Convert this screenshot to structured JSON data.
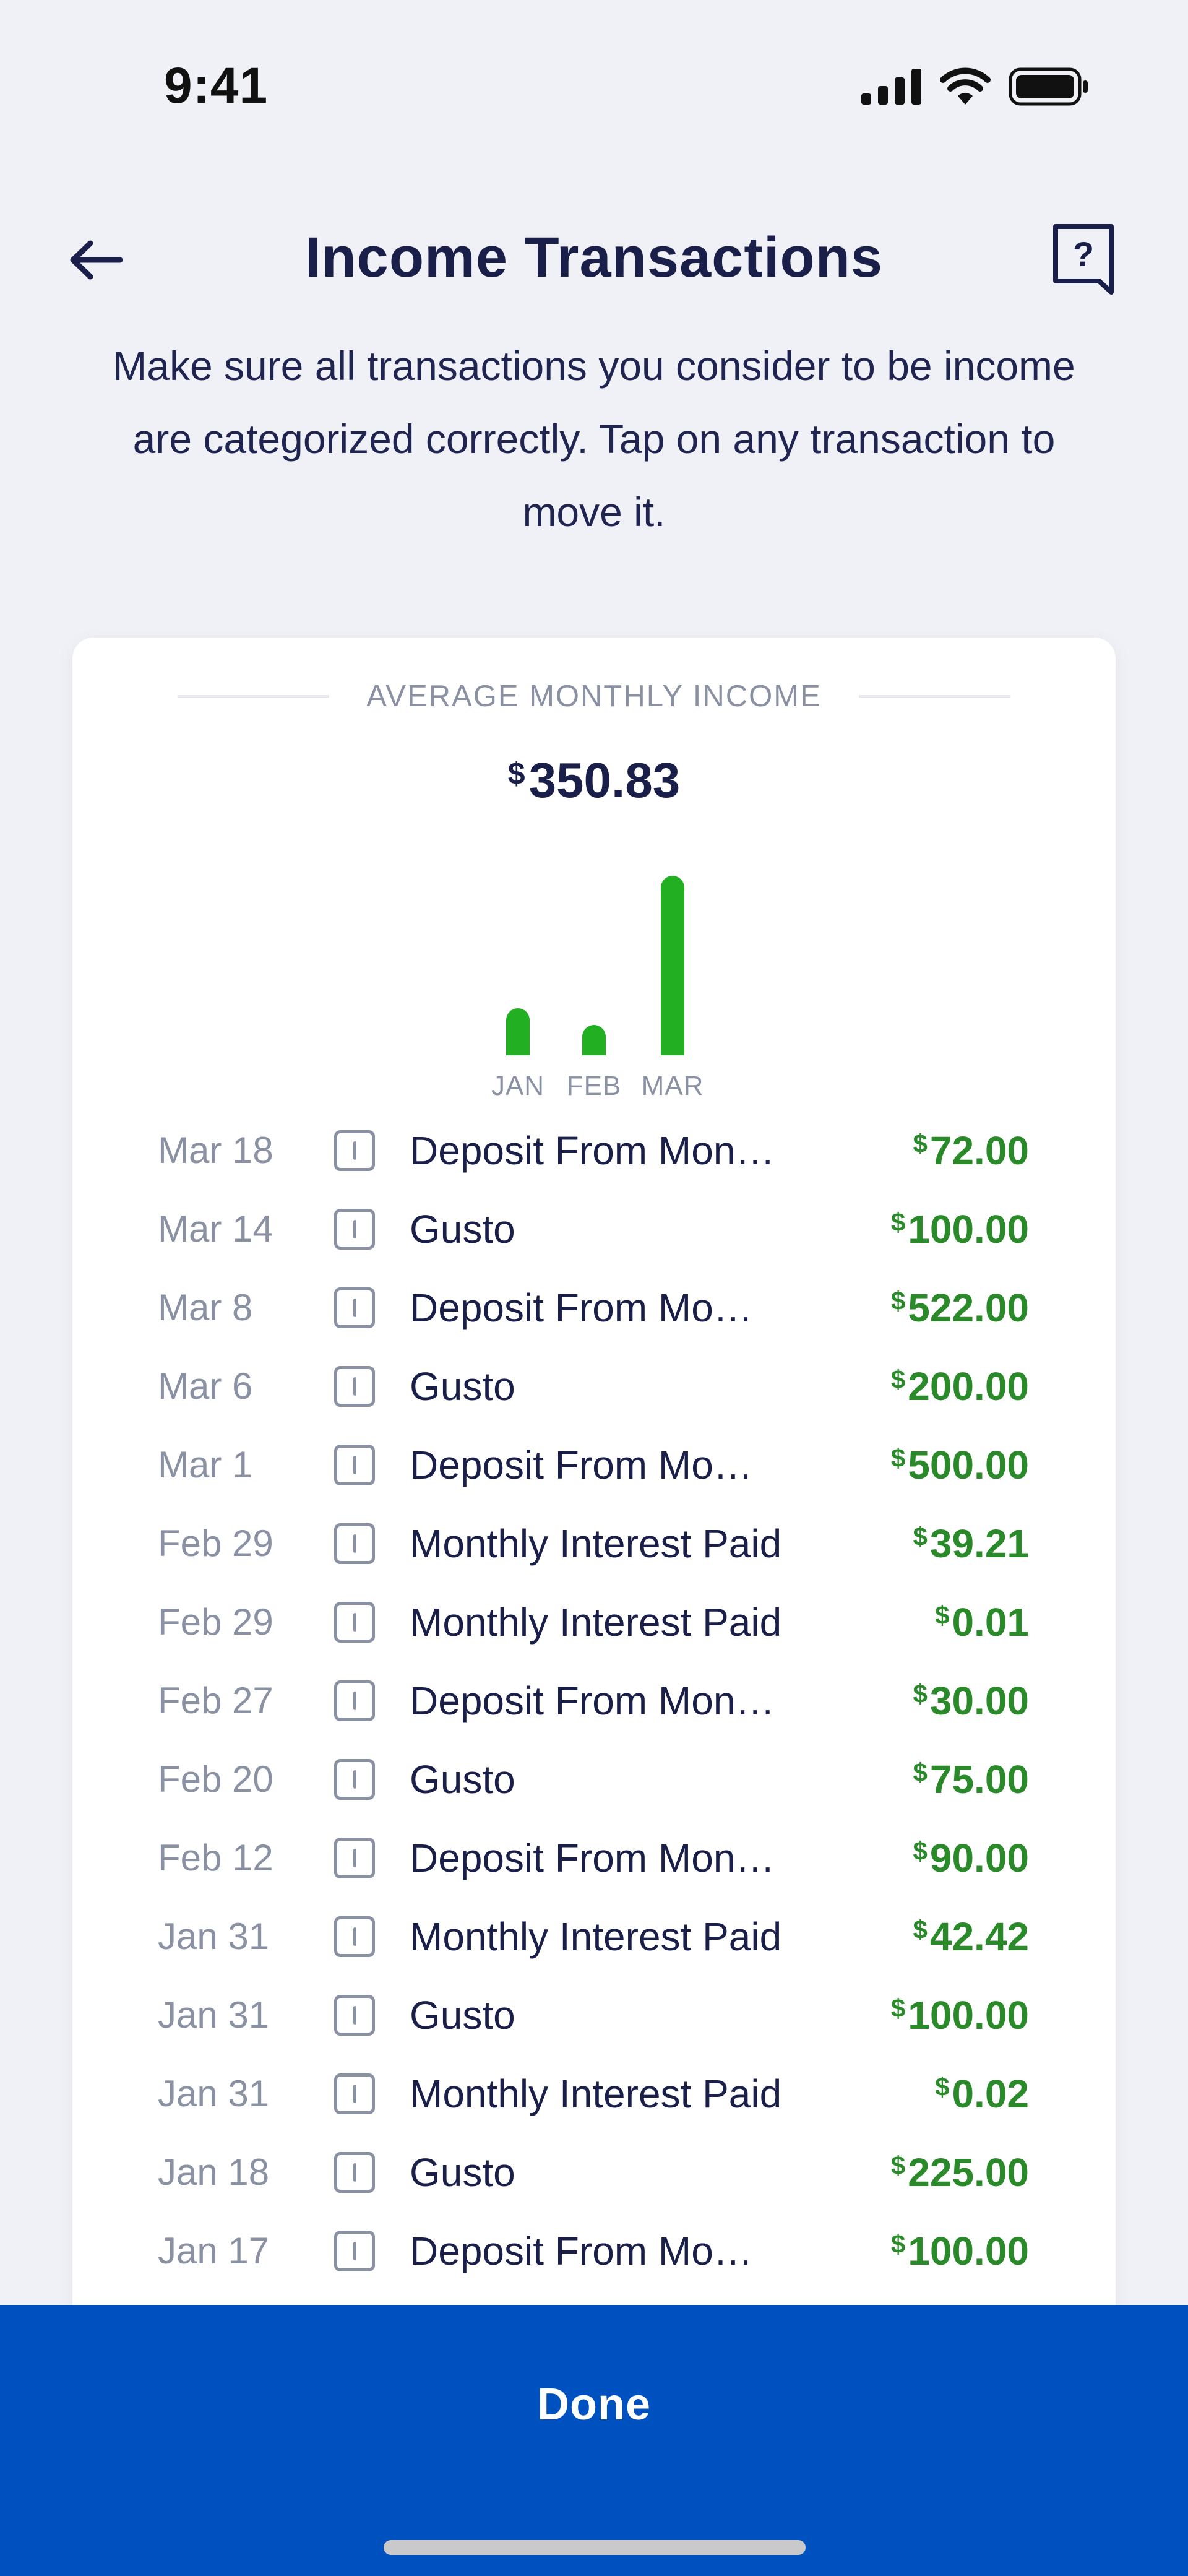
{
  "status_bar": {
    "time": "9:41"
  },
  "header": {
    "title": "Income Transactions"
  },
  "subtitle": "Make sure all transactions you consider to be income are categorized correctly. Tap on any transaction to move it.",
  "summary": {
    "label": "AVERAGE MONTHLY INCOME",
    "currency": "$",
    "amount": "350.83"
  },
  "chart_data": {
    "type": "bar",
    "categories": [
      "JAN",
      "FEB",
      "MAR"
    ],
    "values": [
      367.44,
      234.22,
      1394.0
    ],
    "color": "#22b022"
  },
  "transactions": [
    {
      "date": "Mar 18",
      "name": "Deposit From Mon…",
      "currency": "$",
      "amount": "72.00"
    },
    {
      "date": "Mar 14",
      "name": "Gusto",
      "currency": "$",
      "amount": "100.00"
    },
    {
      "date": "Mar 8",
      "name": "Deposit From Mo…",
      "currency": "$",
      "amount": "522.00"
    },
    {
      "date": "Mar 6",
      "name": "Gusto",
      "currency": "$",
      "amount": "200.00"
    },
    {
      "date": "Mar 1",
      "name": "Deposit From Mo…",
      "currency": "$",
      "amount": "500.00"
    },
    {
      "date": "Feb 29",
      "name": "Monthly Interest Paid",
      "currency": "$",
      "amount": "39.21"
    },
    {
      "date": "Feb 29",
      "name": "Monthly Interest Paid",
      "currency": "$",
      "amount": "0.01"
    },
    {
      "date": "Feb 27",
      "name": "Deposit From Mon…",
      "currency": "$",
      "amount": "30.00"
    },
    {
      "date": "Feb 20",
      "name": "Gusto",
      "currency": "$",
      "amount": "75.00"
    },
    {
      "date": "Feb 12",
      "name": "Deposit From Mon…",
      "currency": "$",
      "amount": "90.00"
    },
    {
      "date": "Jan 31",
      "name": "Monthly Interest Paid",
      "currency": "$",
      "amount": "42.42"
    },
    {
      "date": "Jan 31",
      "name": "Gusto",
      "currency": "$",
      "amount": "100.00"
    },
    {
      "date": "Jan 31",
      "name": "Monthly Interest Paid",
      "currency": "$",
      "amount": "0.02"
    },
    {
      "date": "Jan 18",
      "name": "Gusto",
      "currency": "$",
      "amount": "225.00"
    },
    {
      "date": "Jan 17",
      "name": "Deposit From Mo…",
      "currency": "$",
      "amount": "100.00"
    }
  ],
  "footer": {
    "done_label": "Done"
  },
  "colors": {
    "background": "#f0f1f6",
    "primary": "#0051c0",
    "income_green": "#2a8a2a",
    "title": "#1a1f4a"
  },
  "icons": {
    "back": "arrow-left-icon",
    "help": "help-chat-icon",
    "category": "income-category-icon"
  }
}
